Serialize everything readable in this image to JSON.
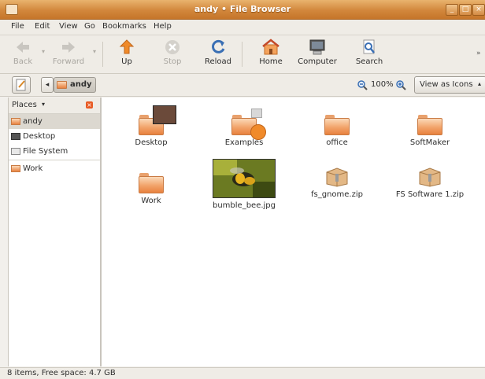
{
  "window": {
    "title": "andy • File Browser"
  },
  "menubar": {
    "items": [
      "File",
      "Edit",
      "View",
      "Go",
      "Bookmarks",
      "Help"
    ]
  },
  "toolbar": {
    "back": "Back",
    "forward": "Forward",
    "up": "Up",
    "stop": "Stop",
    "reload": "Reload",
    "home": "Home",
    "computer": "Computer",
    "search": "Search"
  },
  "location": {
    "current": "andy",
    "zoom": "100%",
    "view_mode": "View as Icons"
  },
  "sidebar": {
    "header": "Places",
    "items": [
      {
        "label": "andy",
        "icon": "home-folder-icon",
        "selected": true
      },
      {
        "label": "Desktop",
        "icon": "desktop-icon"
      },
      {
        "label": "File System",
        "icon": "drive-icon"
      },
      {
        "label": "Work",
        "icon": "folder-icon"
      }
    ]
  },
  "files": [
    {
      "name": "Desktop",
      "icon": "folder-icon"
    },
    {
      "name": "Examples",
      "icon": "folder-icon"
    },
    {
      "name": "office",
      "icon": "folder-icon"
    },
    {
      "name": "SoftMaker",
      "icon": "folder-icon"
    },
    {
      "name": "Work",
      "icon": "folder-icon"
    },
    {
      "name": "bumble_bee.jpg",
      "icon": "image-thumbnail"
    },
    {
      "name": "fs_gnome.zip",
      "icon": "archive-icon"
    },
    {
      "name": "FS Software 1.zip",
      "icon": "archive-icon"
    }
  ],
  "status": {
    "text": "8 items, Free space: 4.7 GB"
  },
  "colors": {
    "titlebar": "#d2873c",
    "folder": "#f2a46a",
    "selection": "#dcd8d0"
  }
}
